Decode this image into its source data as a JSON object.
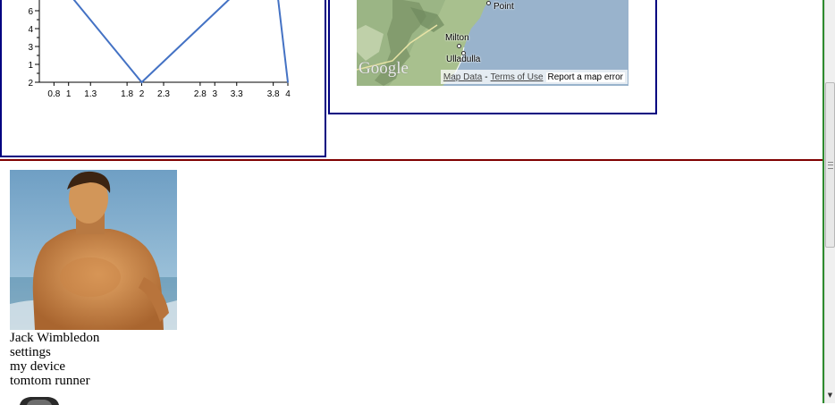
{
  "chart_data": {
    "type": "line",
    "x": [
      0.6,
      2,
      3.8,
      4
    ],
    "y": [
      10.5,
      2,
      10.5,
      2
    ],
    "x_tick_labels": [
      "0.8",
      "1",
      "1.3",
      "1.8",
      "2",
      "2.3",
      "2.8",
      "3",
      "3.3",
      "3.8",
      "4"
    ],
    "x_ticks": [
      0.8,
      1,
      1.3,
      1.8,
      2,
      2.3,
      2.8,
      3,
      3.3,
      3.8,
      4
    ],
    "y_tick_labels": [
      "2",
      "1",
      "3",
      "4",
      "6"
    ],
    "y_ticks": [
      2,
      1,
      3,
      4,
      6
    ],
    "xlim": [
      0.6,
      4
    ],
    "ylim": [
      2,
      7
    ],
    "line_color": "#4472c4",
    "grid": false
  },
  "map": {
    "labels": [
      "Point",
      "Milton",
      "Ulladulla"
    ],
    "logo": "Google",
    "footer": {
      "map_data": "Map Data",
      "separator": "-",
      "terms": "Terms of Use",
      "report": "Report a map error"
    },
    "water_color": "#99b3cc",
    "land_color": "#a5bf8c"
  },
  "profile": {
    "name": "Jack Wimbledon",
    "links": [
      "settings",
      "my device",
      "tomtom runner"
    ]
  },
  "colors": {
    "panel_border": "#000080",
    "frame_separator": "#800000",
    "frame_right_border": "#2e8b2e"
  },
  "icons": {
    "scroll_grip": "grip-lines-icon",
    "scroll_down": "arrow-down-icon"
  }
}
